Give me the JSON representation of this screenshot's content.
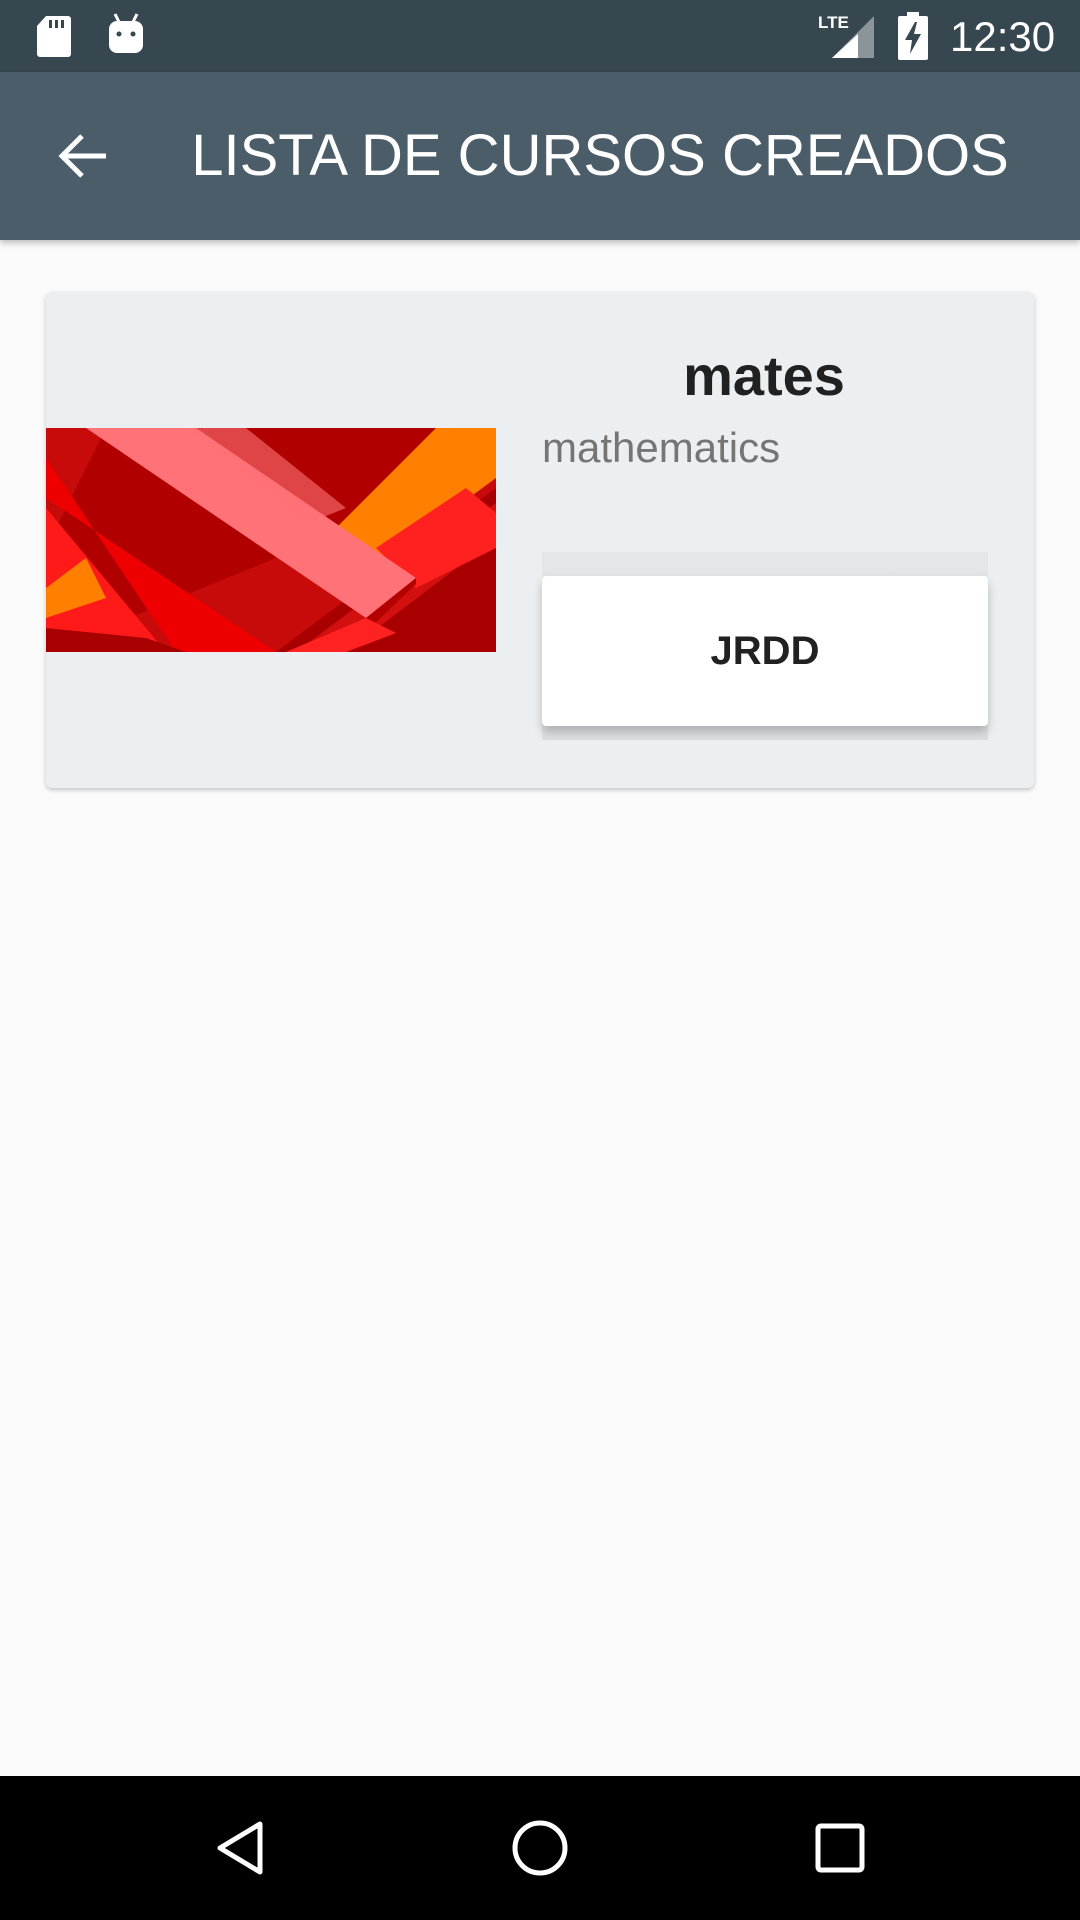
{
  "status_bar": {
    "time": "12:30",
    "network_label": "LTE",
    "icons": [
      "sd-card-icon",
      "android-icon",
      "lte-signal-icon",
      "battery-charging-icon"
    ]
  },
  "app_bar": {
    "title": "LISTA DE CURSOS CREADOS",
    "back_icon": "arrow-back-icon"
  },
  "courses": [
    {
      "name": "mates",
      "subject": "mathematics",
      "button_label": "JRDD"
    }
  ],
  "nav_bar": {
    "icons": [
      "back-triangle-icon",
      "home-circle-icon",
      "recents-square-icon"
    ]
  },
  "colors": {
    "status_bar": "#37474f",
    "app_bar": "#4b5d69",
    "background": "#fafafa",
    "card": "#eceff1"
  }
}
